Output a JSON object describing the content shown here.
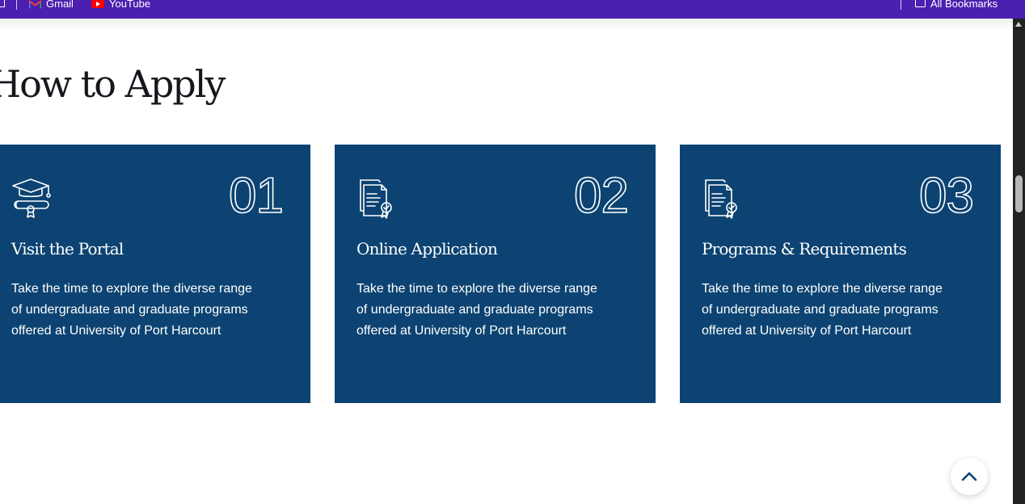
{
  "bookmarks": {
    "items": [
      {
        "label": "Gmail",
        "icon": "gmail-icon"
      },
      {
        "label": "YouTube",
        "icon": "youtube-icon"
      }
    ],
    "all_bookmarks_label": "All Bookmarks",
    "bar_color": "#4b1fb0"
  },
  "section": {
    "title": "How to Apply"
  },
  "cards": [
    {
      "number": "01",
      "icon": "graduation-cap-diploma-icon",
      "title": "Visit the Portal",
      "text": "Take the time to explore the diverse range of undergraduate and graduate programs offered at University of Port Harcourt"
    },
    {
      "number": "02",
      "icon": "certificate-document-icon",
      "title": "Online Application",
      "text": "Take the time to explore the diverse range of undergraduate and graduate programs offered at University of Port Harcourt"
    },
    {
      "number": "03",
      "icon": "certificate-document-icon",
      "title": "Programs & Requirements",
      "text": "Take the time to explore the diverse range of undergraduate and graduate programs offered at University of Port Harcourt"
    }
  ],
  "colors": {
    "card_background": "#0c4372",
    "card_text": "#ffffff",
    "title_text": "#15171c"
  },
  "back_to_top": {
    "icon": "chevron-up-icon"
  }
}
